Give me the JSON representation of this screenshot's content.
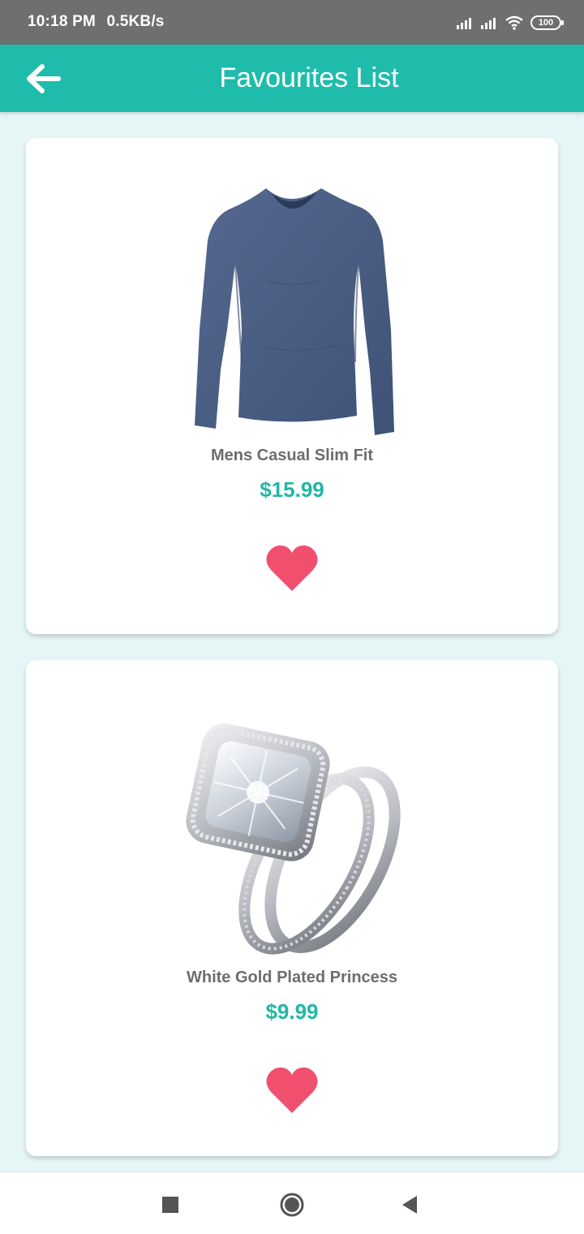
{
  "status_bar": {
    "time": "10:18 PM",
    "speed": "0.5KB/s",
    "battery": "100"
  },
  "app_bar": {
    "title": "Favourites List"
  },
  "colors": {
    "accent": "#1fbcab",
    "price": "#21b6a6",
    "heart": "#f0506e",
    "background": "#e6f6f6"
  },
  "favourites": [
    {
      "name": "Mens Casual Slim Fit",
      "price": "$15.99",
      "image": "long-sleeve-shirt",
      "favourited": true
    },
    {
      "name": "White Gold Plated Princess",
      "price": "$9.99",
      "image": "diamond-ring",
      "favourited": true
    }
  ],
  "nav": {
    "icons": [
      "recents-square-icon",
      "home-circle-icon",
      "back-triangle-icon"
    ]
  }
}
